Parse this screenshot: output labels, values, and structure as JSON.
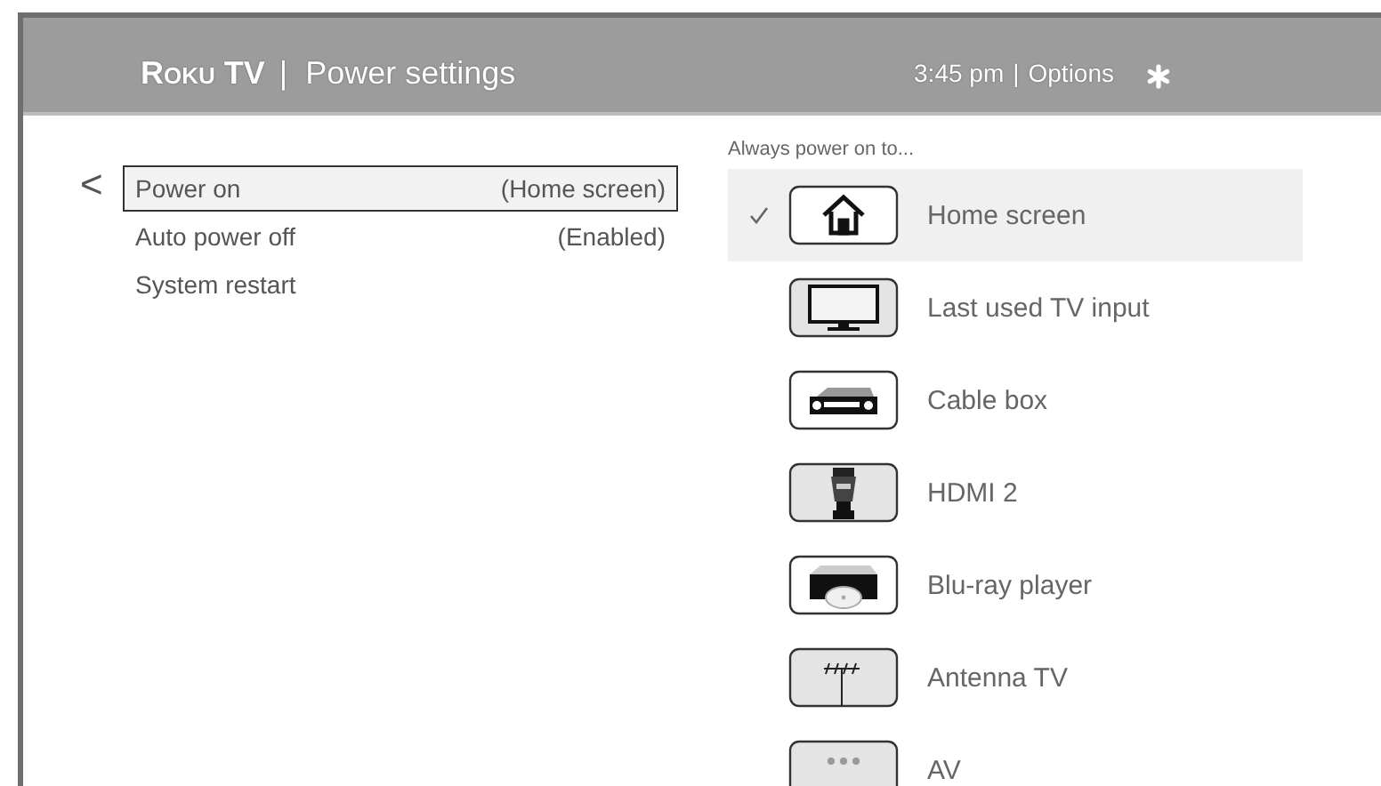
{
  "header": {
    "brand": "Roku TV",
    "separator": "|",
    "title": "Power settings",
    "time": "3:45 pm",
    "time_separator": "|",
    "options": "Options"
  },
  "menu": {
    "back_glyph": "<",
    "items": [
      {
        "label": "Power on",
        "value": "(Home screen)",
        "selected": true
      },
      {
        "label": "Auto power off",
        "value": "(Enabled)",
        "selected": false
      },
      {
        "label": "System restart",
        "selected": false
      }
    ]
  },
  "power_on_list": {
    "heading": "Always power on to...",
    "options": [
      {
        "label": "Home screen",
        "kind": "home",
        "selected": true
      },
      {
        "label": "Last used TV input",
        "kind": "tv",
        "selected": false
      },
      {
        "label": "Cable box",
        "kind": "cable",
        "selected": false
      },
      {
        "label": "HDMI 2",
        "kind": "hdmi",
        "selected": false
      },
      {
        "label": "Blu-ray player",
        "kind": "bluray",
        "selected": false
      },
      {
        "label": "Antenna TV",
        "kind": "antenna",
        "selected": false
      },
      {
        "label": "AV",
        "kind": "av",
        "selected": false
      }
    ]
  }
}
